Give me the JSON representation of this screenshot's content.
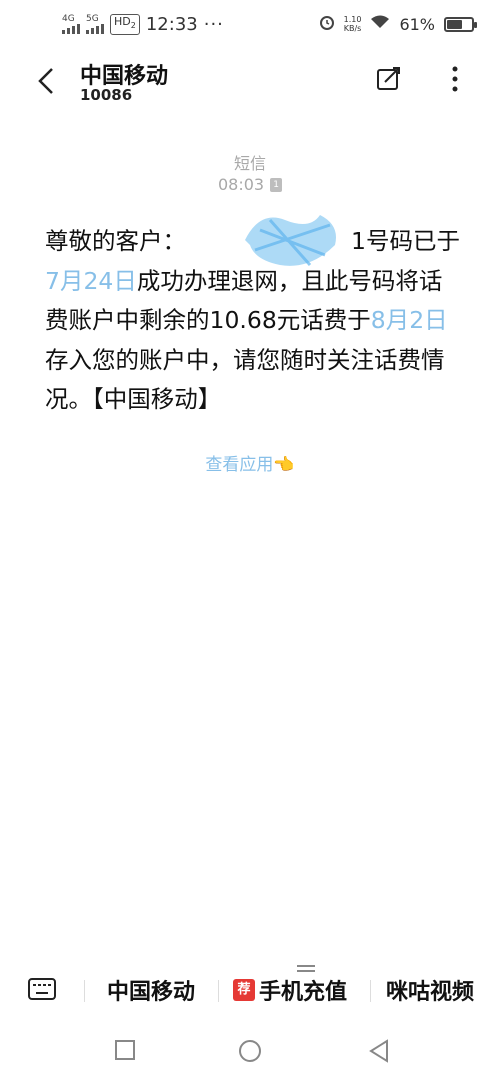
{
  "status_bar": {
    "net1": "4G",
    "net2": "5G",
    "hd": "HD",
    "hd_sub": "2",
    "time": "12:33",
    "more": "···",
    "speed_value": "1.10",
    "speed_unit": "KB/s",
    "battery_text": "61%",
    "battery_level": 0.61
  },
  "header": {
    "contact_name": "中国移动",
    "contact_number": "10086"
  },
  "conversation": {
    "message_type": "短信",
    "time": "08:03",
    "sim_slot": "1",
    "message": {
      "part1": "尊敬的客户：",
      "part1b": "1号码已于",
      "date1": "7月24日",
      "part2": "成功办理退网，且此号码将话费账户中剩余的10.68元话费于",
      "date2": "8月2日",
      "part3": "存入您的账户中，请您随时关注话费情况。【中国移动】"
    },
    "apps_link": "查看应用👈"
  },
  "bottom_menu": {
    "item1": "中国移动",
    "item2_badge": "荐",
    "item2": "手机充值",
    "item3": "咪咕视频"
  }
}
